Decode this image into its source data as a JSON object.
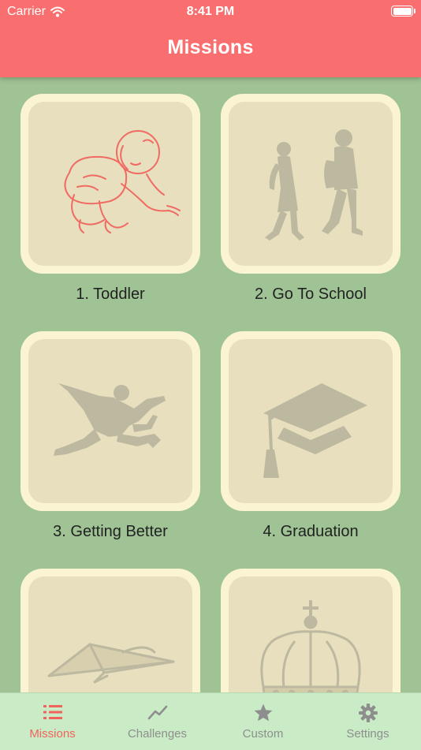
{
  "status_bar": {
    "carrier": "Carrier",
    "time": "8:41 PM"
  },
  "header": {
    "title": "Missions"
  },
  "missions": [
    {
      "label": "1. Toddler",
      "icon": "crawling-baby-icon",
      "state": "unlocked"
    },
    {
      "label": "2. Go To School",
      "icon": "school-kids-icon",
      "state": "locked"
    },
    {
      "label": "3. Getting Better",
      "icon": "jumping-man-icon",
      "state": "locked"
    },
    {
      "label": "4. Graduation",
      "icon": "graduation-cap-icon",
      "state": "locked"
    },
    {
      "label": "",
      "icon": "paper-plane-icon",
      "state": "locked"
    },
    {
      "label": "",
      "icon": "crown-icon",
      "state": "locked"
    }
  ],
  "tabs": [
    {
      "label": "Missions",
      "icon": "list-icon",
      "active": true
    },
    {
      "label": "Challenges",
      "icon": "trend-line-icon",
      "active": false
    },
    {
      "label": "Custom",
      "icon": "star-icon",
      "active": false
    },
    {
      "label": "Settings",
      "icon": "gear-icon",
      "active": false
    }
  ],
  "colors": {
    "header": "#f96e6e",
    "background": "#9fc394",
    "tile_frame": "#fbf4d2",
    "tile_inner": "#e7dfbd",
    "unlocked_art": "#ef6b63",
    "locked_art": "#bdb8a0",
    "tab_active": "#f2625c",
    "tab_inactive": "#8e8e8e",
    "tabbar": "#c9ecc6"
  }
}
